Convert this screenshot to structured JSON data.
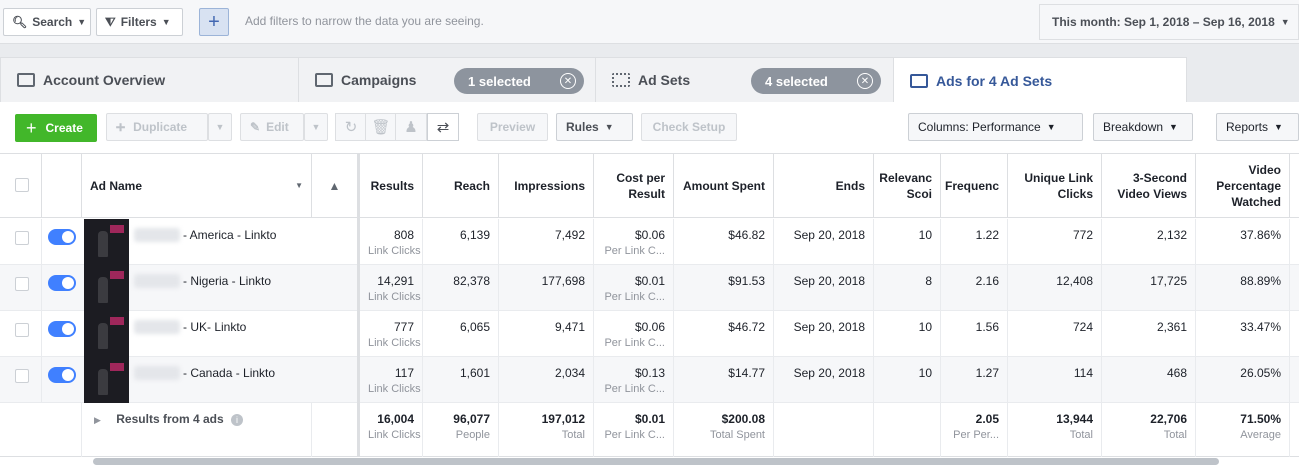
{
  "filterbar": {
    "search_label": "Search",
    "filters_label": "Filters",
    "hint": "Add filters to narrow the data you are seeing.",
    "date_range": "This month: Sep 1, 2018 – Sep 16, 2018"
  },
  "tabs": {
    "account": "Account Overview",
    "campaigns": "Campaigns",
    "campaigns_selected": "1 selected",
    "adsets": "Ad Sets",
    "adsets_selected": "4 selected",
    "ads": "Ads for 4 Ad Sets"
  },
  "toolbar": {
    "create": "Create",
    "duplicate": "Duplicate",
    "edit": "Edit",
    "preview": "Preview",
    "rules": "Rules",
    "check_setup": "Check Setup",
    "columns": "Columns: Performance",
    "breakdown": "Breakdown",
    "reports": "Reports"
  },
  "columns": {
    "ad_name": "Ad Name",
    "results": "Results",
    "reach": "Reach",
    "impressions": "Impressions",
    "cost_per_result_1": "Cost per",
    "cost_per_result_2": "Result",
    "amount_spent": "Amount Spent",
    "ends": "Ends",
    "relevance_1": "Relevanc",
    "relevance_2": "Scoi",
    "frequency": "Frequenc",
    "unique_link_1": "Unique Link",
    "unique_link_2": "Clicks",
    "video_3s_1": "3-Second",
    "video_3s_2": "Video Views",
    "video_pct_1": "Video",
    "video_pct_2": "Percentage",
    "video_pct_3": "Watched"
  },
  "rows": [
    {
      "name": "- America - Linkto",
      "results": "808",
      "results_sub": "Link Clicks",
      "reach": "6,139",
      "impressions": "7,492",
      "cpr": "$0.06",
      "cpr_sub": "Per Link C...",
      "spent": "$46.82",
      "ends": "Sep 20, 2018",
      "relevance": "10",
      "frequency": "1.22",
      "unique_clicks": "772",
      "video_3s": "2,132",
      "video_pct": "37.86%"
    },
    {
      "name": "- Nigeria - Linkto",
      "results": "14,291",
      "results_sub": "Link Clicks",
      "reach": "82,378",
      "impressions": "177,698",
      "cpr": "$0.01",
      "cpr_sub": "Per Link C...",
      "spent": "$91.53",
      "ends": "Sep 20, 2018",
      "relevance": "8",
      "frequency": "2.16",
      "unique_clicks": "12,408",
      "video_3s": "17,725",
      "video_pct": "88.89%"
    },
    {
      "name": "- UK- Linkto",
      "results": "777",
      "results_sub": "Link Clicks",
      "reach": "6,065",
      "impressions": "9,471",
      "cpr": "$0.06",
      "cpr_sub": "Per Link C...",
      "spent": "$46.72",
      "ends": "Sep 20, 2018",
      "relevance": "10",
      "frequency": "1.56",
      "unique_clicks": "724",
      "video_3s": "2,361",
      "video_pct": "33.47%"
    },
    {
      "name": "- Canada - Linkto",
      "results": "117",
      "results_sub": "Link Clicks",
      "reach": "1,601",
      "impressions": "2,034",
      "cpr": "$0.13",
      "cpr_sub": "Per Link C...",
      "spent": "$14.77",
      "ends": "Sep 20, 2018",
      "relevance": "10",
      "frequency": "1.27",
      "unique_clicks": "114",
      "video_3s": "468",
      "video_pct": "26.05%"
    }
  ],
  "totals": {
    "label": "Results from 4 ads",
    "results": "16,004",
    "results_sub": "Link Clicks",
    "reach": "96,077",
    "reach_sub": "People",
    "impressions": "197,012",
    "impressions_sub": "Total",
    "cpr": "$0.01",
    "cpr_sub": "Per Link C...",
    "spent": "$200.08",
    "spent_sub": "Total Spent",
    "frequency": "2.05",
    "frequency_sub": "Per Per...",
    "unique_clicks": "13,944",
    "unique_clicks_sub": "Total",
    "video_3s": "22,706",
    "video_3s_sub": "Total",
    "video_pct": "71.50%",
    "video_pct_sub": "Average"
  }
}
